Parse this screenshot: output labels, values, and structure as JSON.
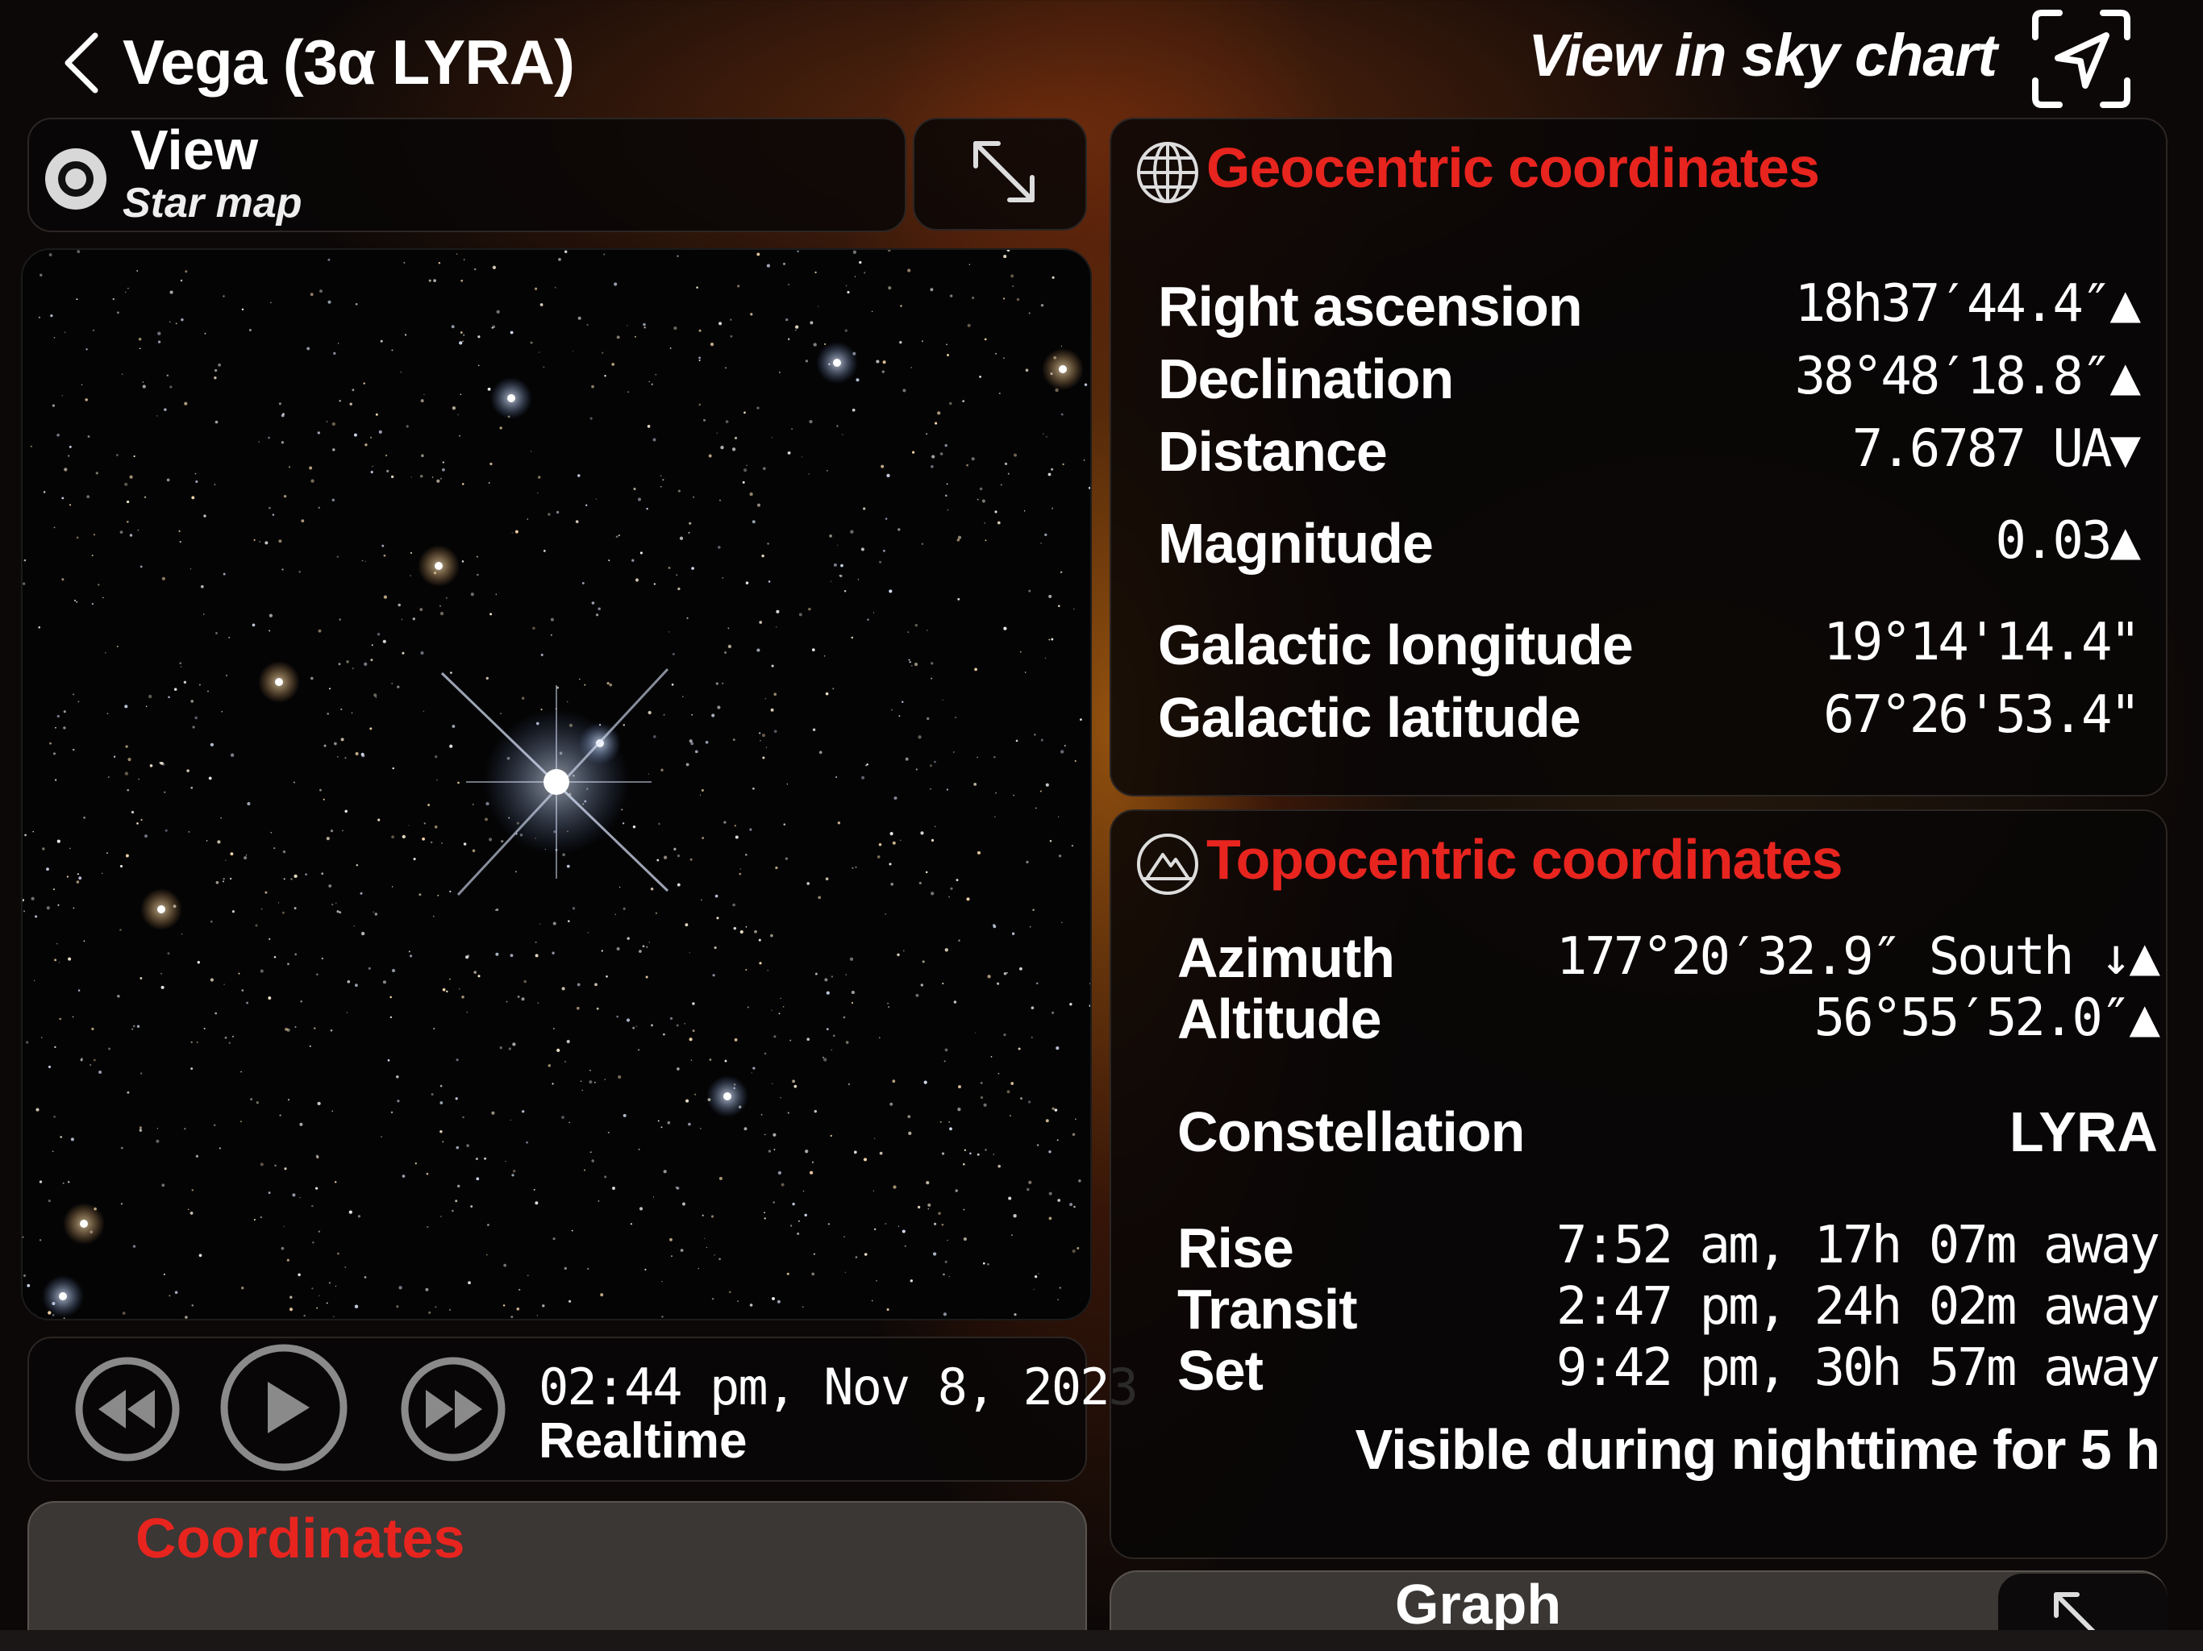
{
  "header": {
    "title": "Vega (3α LYRA)",
    "sky_chart_label": "View in sky chart"
  },
  "view": {
    "title": "View",
    "subtitle": "Star map"
  },
  "playback": {
    "time": "02:44 pm, Nov 8, 2023",
    "mode": "Realtime"
  },
  "tabs": {
    "coordinates": "Coordinates",
    "graph": "Graph"
  },
  "geocentric": {
    "title": "Geocentric coordinates",
    "rows": [
      {
        "label": "Right ascension",
        "value": "18h37′44.4″▲"
      },
      {
        "label": "Declination",
        "value": "38°48′18.8″▲"
      },
      {
        "label": "Distance",
        "value": "7.6787 UA▼"
      },
      {
        "label": "Magnitude",
        "value": "0.03▲"
      },
      {
        "label": "Galactic longitude",
        "value": "19°14'14.4\""
      },
      {
        "label": "Galactic latitude",
        "value": "67°26'53.4\""
      }
    ]
  },
  "topocentric": {
    "title": "Topocentric coordinates",
    "rows": [
      {
        "label": "Azimuth",
        "value": "177°20′32.9″ South ↓▲"
      },
      {
        "label": "Altitude",
        "value": "56°55′52.0″▲"
      },
      {
        "label": "Constellation",
        "value": "LYRA"
      },
      {
        "label": "Rise",
        "value": "7:52 am, 17h 07m away"
      },
      {
        "label": "Transit",
        "value": "2:47 pm, 24h 02m away"
      },
      {
        "label": "Set",
        "value": "9:42 pm, 30h 57m away"
      }
    ],
    "visibility": "Visible during nighttime for 5 h"
  },
  "colors": {
    "accent_red": "#e8241f",
    "panel": "#080606",
    "tab": "#3a3735"
  }
}
